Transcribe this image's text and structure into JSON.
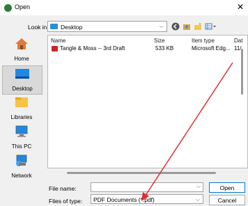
{
  "window": {
    "title": "Open"
  },
  "lookin": {
    "label": "Look in:",
    "value": "Desktop"
  },
  "places": [
    {
      "label": "Home"
    },
    {
      "label": "Desktop"
    },
    {
      "label": "Libraries"
    },
    {
      "label": "This PC"
    },
    {
      "label": "Network"
    }
  ],
  "columns": [
    "Name",
    "Size",
    "Item type",
    "Dat"
  ],
  "files": [
    {
      "name": "Tangle & Moss -- 3rd Draft",
      "size": "533 KB",
      "type": "Microsoft Edg...",
      "date": "11/"
    }
  ],
  "filename": {
    "label": "File name:",
    "value": ""
  },
  "filetype": {
    "label": "Files of type:",
    "value": "PDF Documents (*.pdf)"
  },
  "buttons": {
    "open": "Open",
    "cancel": "Cancel"
  },
  "colors": {
    "arrow": "#e03030",
    "selected_place": "#d9d9d9",
    "accent": "#0078d4"
  }
}
